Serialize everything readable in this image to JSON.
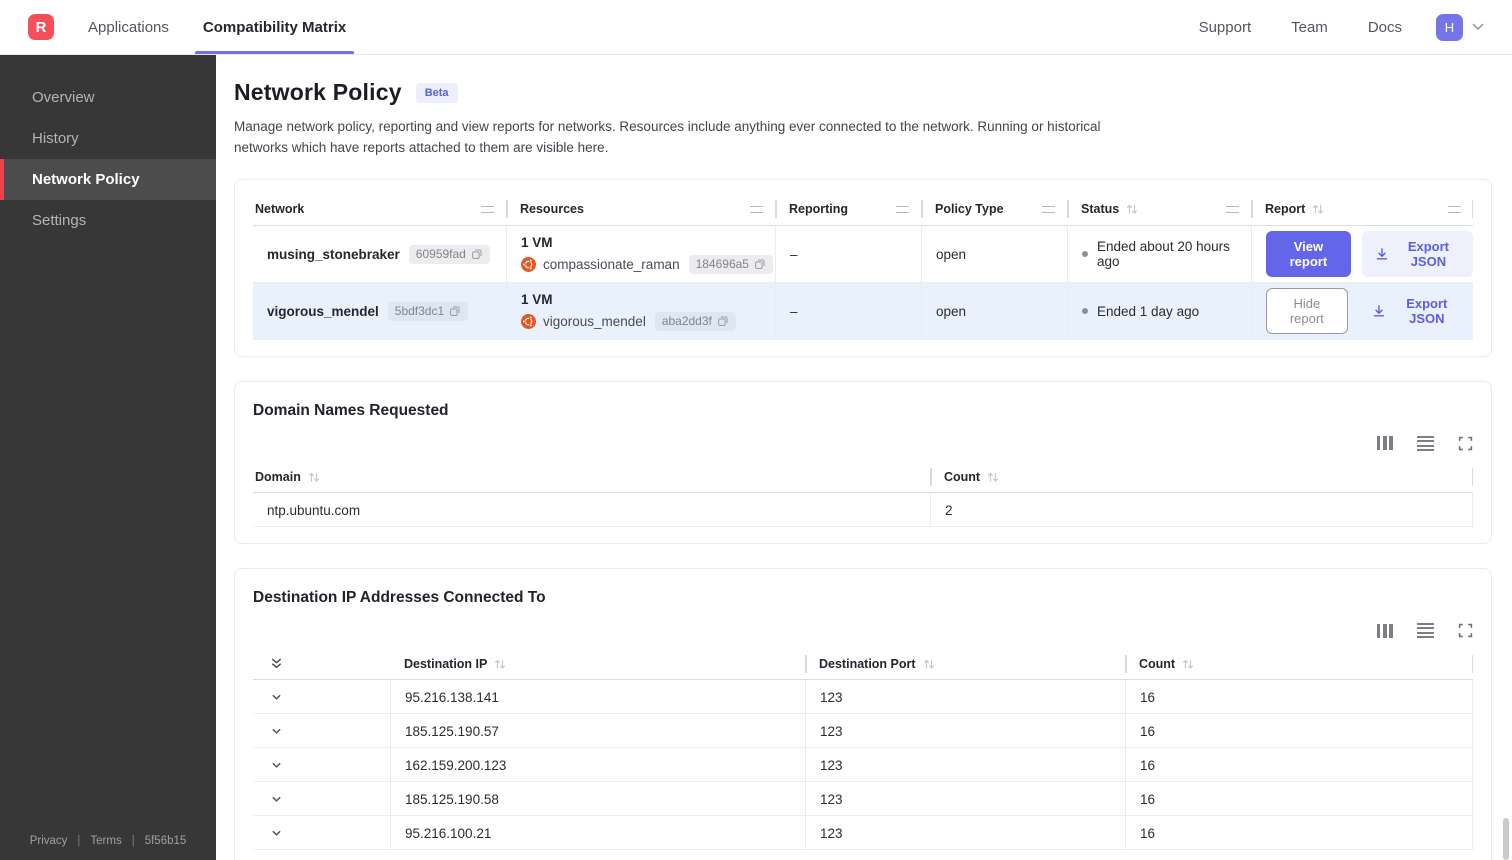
{
  "colors": {
    "accent_purple": "#6366e8",
    "brand_red": "#f4505c",
    "sidebar_active_red": "#ef4050",
    "selected_row_blue": "#e9f1fc",
    "ubuntu_orange": "#e95420",
    "beta_badge_bg": "#eceefb"
  },
  "nav": {
    "logo_letter": "R",
    "items": [
      {
        "label": "Applications"
      },
      {
        "label": "Compatibility Matrix"
      }
    ],
    "right_items": [
      {
        "label": "Support"
      },
      {
        "label": "Team"
      },
      {
        "label": "Docs"
      }
    ],
    "avatar_letter": "H"
  },
  "sidebar": {
    "items": [
      {
        "label": "Overview"
      },
      {
        "label": "History"
      },
      {
        "label": "Network Policy"
      },
      {
        "label": "Settings"
      }
    ],
    "footer": {
      "privacy": "Privacy",
      "terms": "Terms",
      "build": "5f56b15"
    }
  },
  "page": {
    "title": "Network Policy",
    "badge": "Beta",
    "description": "Manage network policy, reporting and view reports for networks. Resources include anything ever connected to the network. Running or historical networks which have reports attached to them are visible here."
  },
  "network_table": {
    "columns": {
      "network": "Network",
      "resources": "Resources",
      "reporting": "Reporting",
      "policy_type": "Policy Type",
      "status": "Status",
      "report": "Report"
    },
    "rows": [
      {
        "network_name": "musing_stonebraker",
        "network_id": "60959fad",
        "vm_count": "1 VM",
        "resource_name": "compassionate_raman",
        "resource_id": "184696a5",
        "reporting": "–",
        "policy_type": "open",
        "status": "Ended about 20 hours ago",
        "report_button": "View report",
        "export_button": "Export JSON"
      },
      {
        "network_name": "vigorous_mendel",
        "network_id": "5bdf3dc1",
        "vm_count": "1 VM",
        "resource_name": "vigorous_mendel",
        "resource_id": "aba2dd3f",
        "reporting": "–",
        "policy_type": "open",
        "status": "Ended 1 day ago",
        "report_button": "Hide report",
        "export_button": "Export JSON"
      }
    ]
  },
  "domains_card": {
    "title": "Domain Names Requested",
    "toolbar_icons": [
      "columns-icon",
      "rows-icon",
      "fullscreen-icon"
    ],
    "columns": {
      "domain": "Domain",
      "count": "Count"
    },
    "rows": [
      {
        "domain": "ntp.ubuntu.com",
        "count": "2"
      }
    ]
  },
  "destinations_card": {
    "title": "Destination IP Addresses Connected To",
    "toolbar_icons": [
      "columns-icon",
      "rows-icon",
      "fullscreen-icon"
    ],
    "columns": {
      "ip": "Destination IP",
      "port": "Destination Port",
      "count": "Count"
    },
    "rows": [
      {
        "ip": "95.216.138.141",
        "port": "123",
        "count": "16"
      },
      {
        "ip": "185.125.190.57",
        "port": "123",
        "count": "16"
      },
      {
        "ip": "162.159.200.123",
        "port": "123",
        "count": "16"
      },
      {
        "ip": "185.125.190.58",
        "port": "123",
        "count": "16"
      },
      {
        "ip": "95.216.100.21",
        "port": "123",
        "count": "16"
      }
    ]
  }
}
